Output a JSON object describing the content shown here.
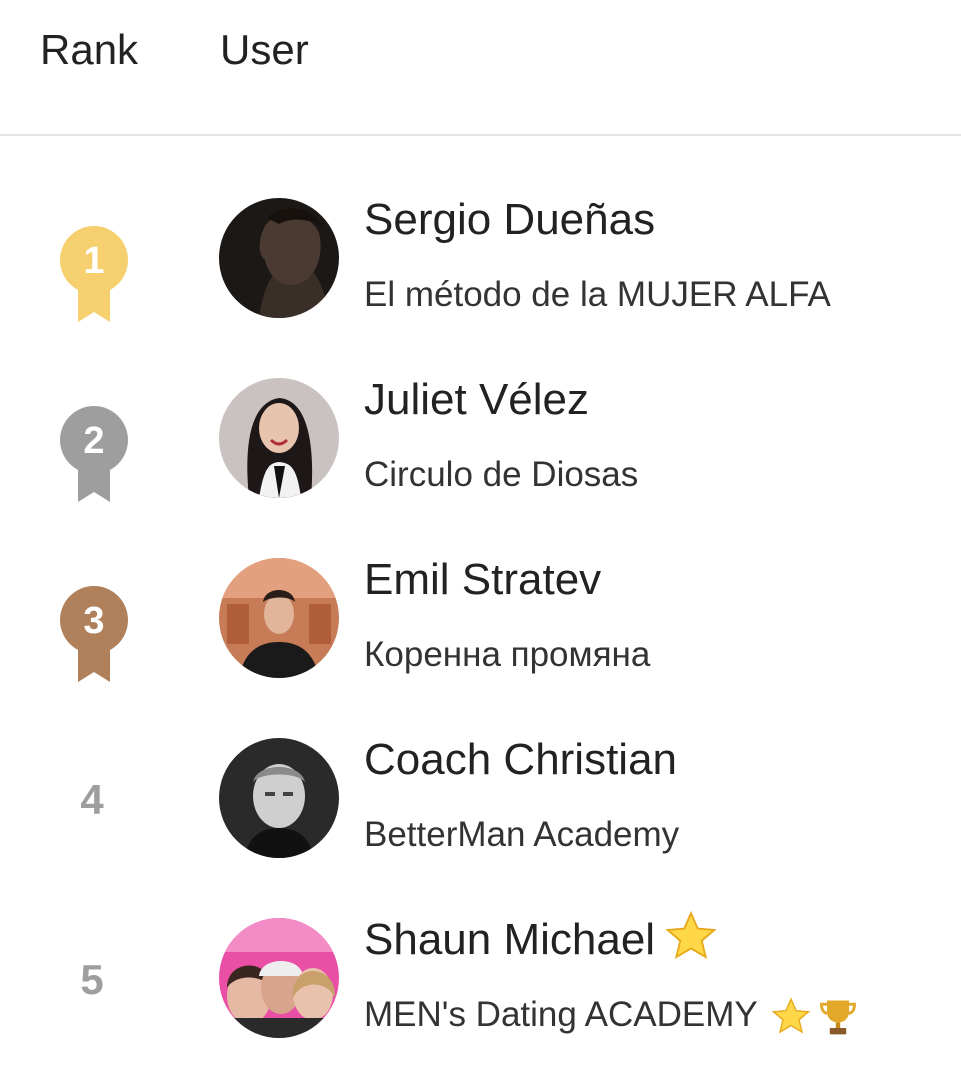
{
  "header": {
    "rank_label": "Rank",
    "user_label": "User"
  },
  "rows": [
    {
      "rank": "1",
      "medal": "gold",
      "medal_color": "#f6cf6e",
      "name": "Sergio Dueñas",
      "subtitle": "El método de la MUJER ALFA",
      "avatar": "avatar-man-dark"
    },
    {
      "rank": "2",
      "medal": "silver",
      "medal_color": "#9e9e9e",
      "name": "Juliet Vélez",
      "subtitle": "Circulo de Diosas",
      "avatar": "avatar-woman"
    },
    {
      "rank": "3",
      "medal": "bronze",
      "medal_color": "#b0805a",
      "name": "Emil Stratev",
      "subtitle": "Коренна промяна",
      "avatar": "avatar-man-room"
    },
    {
      "rank": "4",
      "medal": null,
      "name": "Coach Christian",
      "subtitle": "BetterMan Academy",
      "avatar": "avatar-man-bw"
    },
    {
      "rank": "5",
      "medal": null,
      "name": "Shaun Michael",
      "subtitle": "MEN's Dating ACADEMY",
      "avatar": "avatar-group",
      "name_badges": [
        "star-icon"
      ],
      "subtitle_badges": [
        "star-icon",
        "trophy-icon"
      ]
    }
  ]
}
